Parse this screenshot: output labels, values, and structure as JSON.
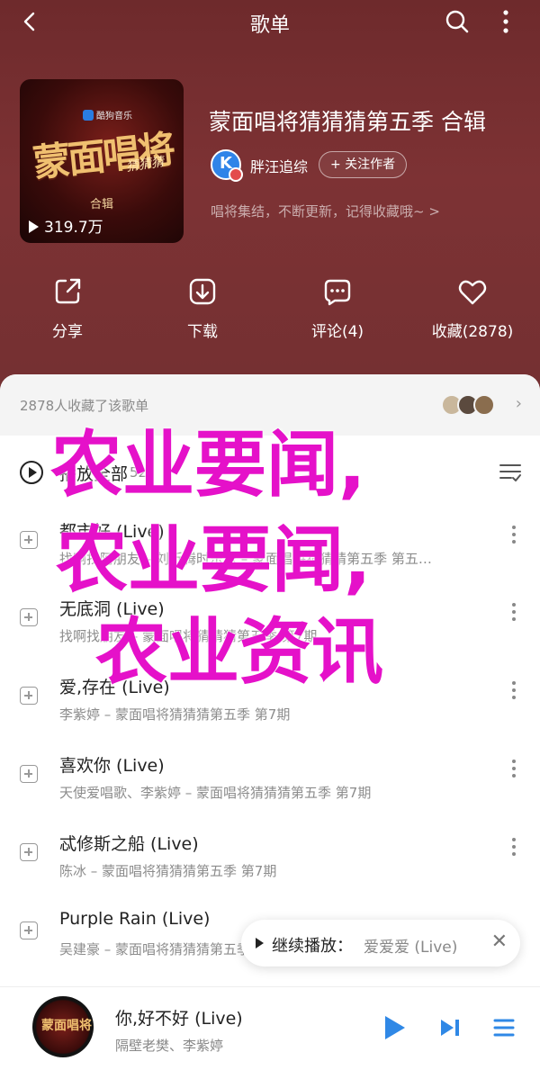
{
  "header": {
    "title": "歌单"
  },
  "playlist": {
    "cover": {
      "brand": "酷狗音乐",
      "logo_text": "蒙面唱将",
      "logo_sub": "猜猜猜",
      "album_tag": "合辑",
      "plays": "319.7万"
    },
    "title": "蒙面唱将猜猜猜第五季 合辑",
    "creator": {
      "name": "胖汪追综",
      "follow_label": "+ 关注作者"
    },
    "description": "唱将集结，不断更新，记得收藏哦~ >"
  },
  "actions": [
    {
      "label": "分享",
      "icon": "share-icon"
    },
    {
      "label": "下载",
      "icon": "download-icon"
    },
    {
      "label": "评论(4)",
      "icon": "comment-icon"
    },
    {
      "label": "收藏(2878)",
      "icon": "heart-icon"
    }
  ],
  "collect": {
    "text": "2878人收藏了该歌单"
  },
  "play_all": {
    "label": "播放全部",
    "count": "52"
  },
  "songs": [
    {
      "name": "都市好 (Live)",
      "meta": "找啊找阿朋友 – 刘折腾时乐乐 – 蒙面唱将猜猜猜第五季 第五…"
    },
    {
      "name": "无底洞 (Live)",
      "meta": "找啊找朋友 – 蒙面唱将猜猜猜第五季 第7期"
    },
    {
      "name": "爱,存在 (Live)",
      "meta": "李紫婷 – 蒙面唱将猜猜猜第五季 第7期"
    },
    {
      "name": "喜欢你 (Live)",
      "meta": "天使爱唱歌、李紫婷 – 蒙面唱将猜猜猜第五季 第7期"
    },
    {
      "name": "忒修斯之船 (Live)",
      "meta": "陈冰 – 蒙面唱将猜猜猜第五季 第7期"
    },
    {
      "name": "Purple Rain (Live)",
      "meta": "吴建豪 – 蒙面唱将猜猜猜第五季"
    }
  ],
  "resume_toast": {
    "label": "继续播放：",
    "song": "爱爱爱 (Live)"
  },
  "now_playing": {
    "disc_text": "蒙面唱将",
    "song": "你,好不好 (Live)",
    "artist": "隔壁老樊、李紫婷"
  },
  "watermark": {
    "line1": "农业要闻,",
    "line2": "农业要闻,",
    "line3": "农业资讯"
  },
  "colors": {
    "hero_bg": "#7d3234",
    "accent_blue": "#2f88e6",
    "watermark": "#e511c9"
  }
}
